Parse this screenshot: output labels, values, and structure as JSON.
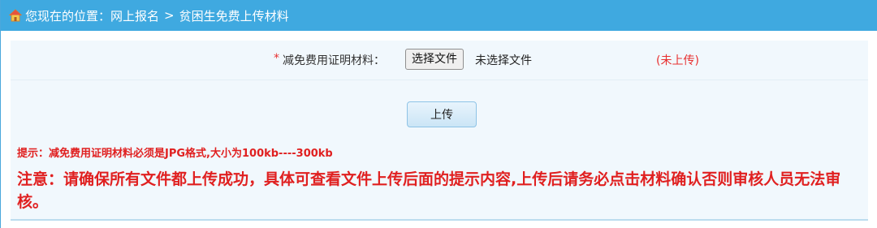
{
  "breadcrumb": {
    "prefix": "您现在的位置：",
    "level1": "网上报名",
    "separator": ">",
    "level2": "贫困生免费上传材料"
  },
  "form": {
    "required_mark": "*",
    "file_label": "减免费用证明材料：",
    "choose_button": "选择文件",
    "no_file_text": "未选择文件",
    "status": "(未上传)",
    "upload_button": "上传"
  },
  "messages": {
    "hint": "提示：减免费用证明材料必须是JPG格式,大小为100kb----300kb",
    "notice": "注意：请确保所有文件都上传成功，具体可查看文件上传后面的提示内容,上传后请务必点击材料确认否则审核人员无法审核。"
  },
  "colors": {
    "header_bg": "#3fa9e0",
    "panel_bg": "#f1f8fd",
    "alert_red": "#e02020"
  },
  "icons": {
    "home": "home-icon"
  }
}
